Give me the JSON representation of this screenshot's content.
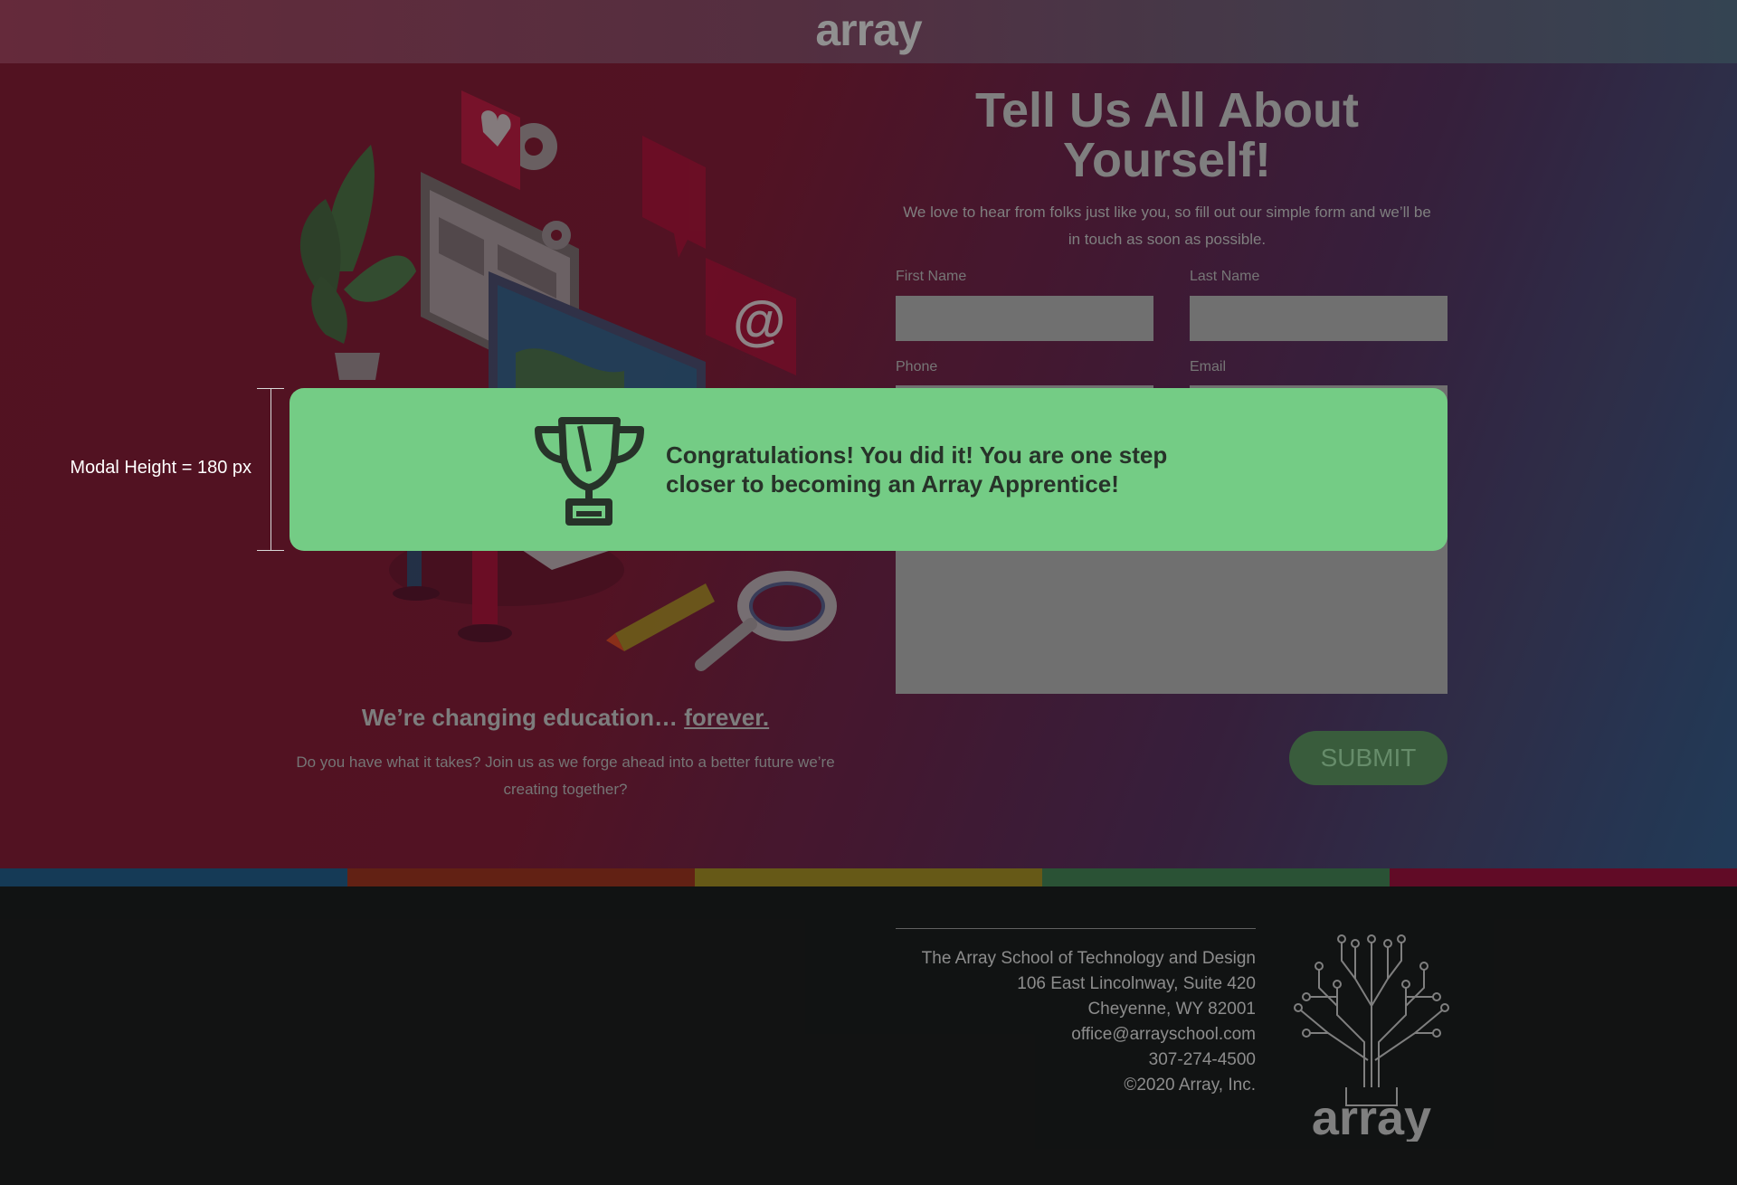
{
  "header": {
    "logo": "array"
  },
  "hero": {
    "tagline_lead": "We’re changing education…",
    "tagline_link": "forever.",
    "subtagline": "Do you have what it takes? Join us as we forge ahead into a better future we’re creating together?"
  },
  "form": {
    "title": "Tell Us All About Yourself!",
    "intro": "We love to hear from folks just like you, so fill out our simple form and we’ll be in touch as soon as possible.",
    "first_name_label": "First Name",
    "last_name_label": "Last Name",
    "phone_label": "Phone",
    "email_label": "Email",
    "submit_label": "SUBMIT"
  },
  "stripes": [
    "#173f5e",
    "#6b2416",
    "#6f6119",
    "#2e5a3a",
    "#6a0d2a"
  ],
  "footer": {
    "lines": [
      "The Array School of Technology and Design",
      "106 East Lincolnway, Suite 420",
      "Cheyenne, WY 82001",
      "office@arrayschool.com",
      "307-274-4500",
      "©2020 Array, Inc."
    ],
    "tree_logo": "array"
  },
  "modal": {
    "icon": "trophy-icon",
    "message": "Congratulations! You did it! You are one step closer to becoming an Array Apprentice!"
  },
  "annotation": {
    "label": "Modal Height = 180 px"
  },
  "colors": {
    "modal_bg": "#74cc85",
    "submit_bg": "#3e6442"
  }
}
